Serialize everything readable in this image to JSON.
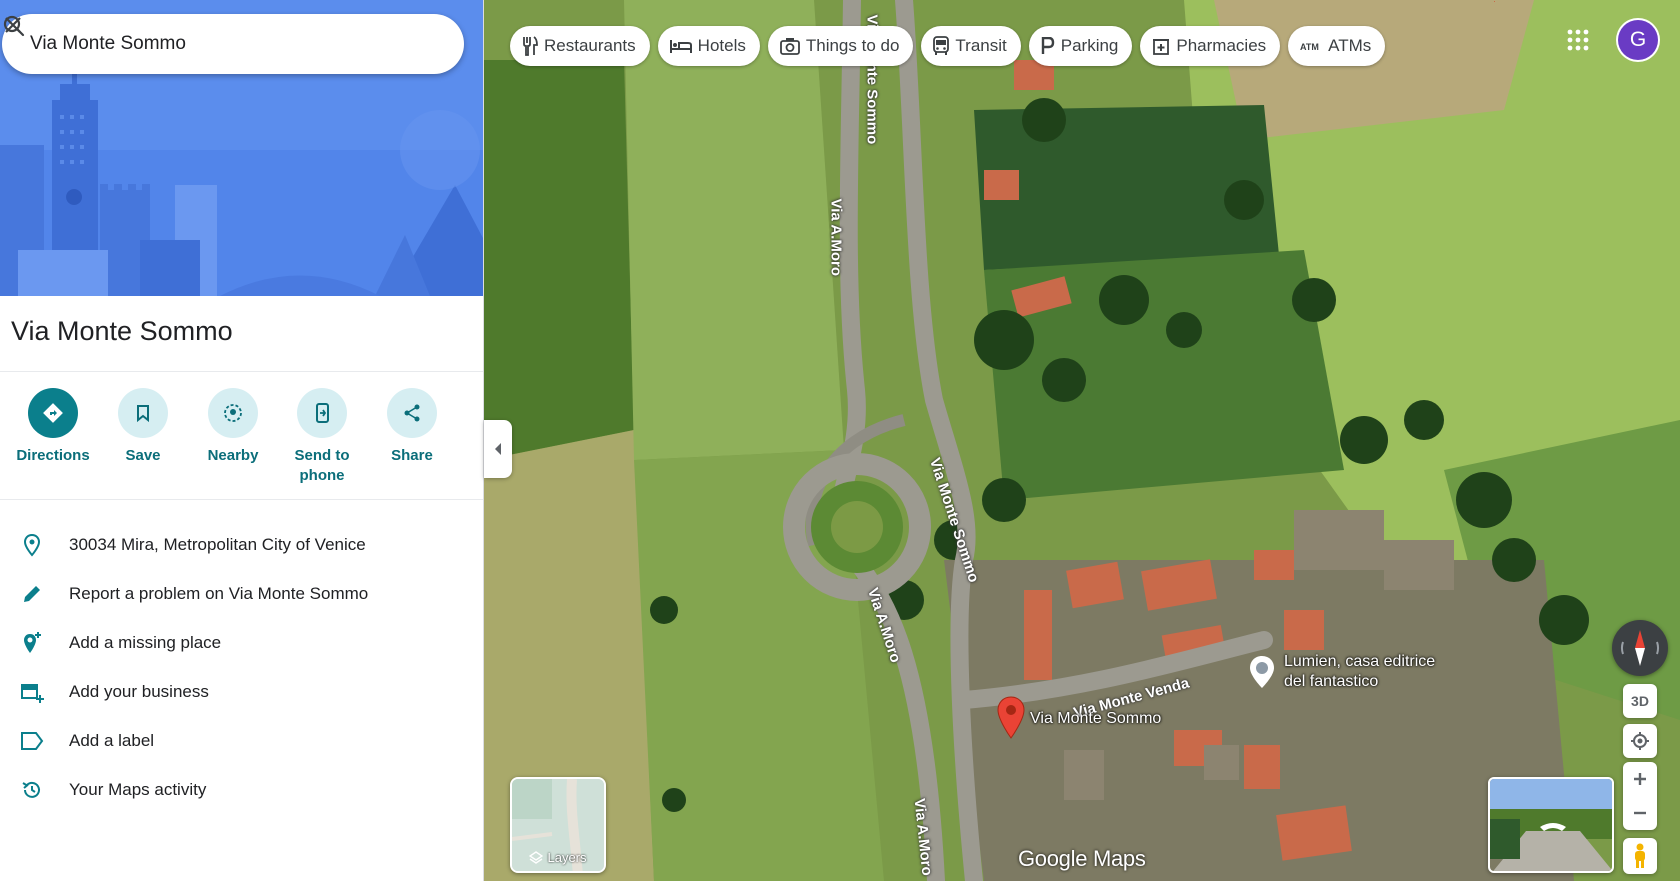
{
  "search": {
    "value": "Via Monte Sommo"
  },
  "place": {
    "title": "Via Monte Sommo"
  },
  "actions": [
    {
      "label": "Directions",
      "icon": "directions-icon"
    },
    {
      "label": "Save",
      "icon": "bookmark-icon"
    },
    {
      "label": "Nearby",
      "icon": "nearby-icon"
    },
    {
      "label": "Send to phone",
      "icon": "send-to-phone-icon"
    },
    {
      "label": "Share",
      "icon": "share-icon"
    }
  ],
  "info": [
    {
      "text": "30034 Mira, Metropolitan City of Venice",
      "icon": "location-pin-icon"
    },
    {
      "text": "Report a problem on Via Monte Sommo",
      "icon": "pencil-icon"
    },
    {
      "text": "Add a missing place",
      "icon": "add-place-icon"
    },
    {
      "text": "Add your business",
      "icon": "add-business-icon"
    },
    {
      "text": "Add a label",
      "icon": "label-icon"
    },
    {
      "text": "Your Maps activity",
      "icon": "history-icon"
    }
  ],
  "chips": [
    {
      "label": "Restaurants",
      "icon": "fork-knife-icon"
    },
    {
      "label": "Hotels",
      "icon": "bed-icon"
    },
    {
      "label": "Things to do",
      "icon": "camera-icon"
    },
    {
      "label": "Transit",
      "icon": "bus-icon"
    },
    {
      "label": "Parking",
      "icon": "parking-icon"
    },
    {
      "label": "Pharmacies",
      "icon": "pharmacy-icon"
    },
    {
      "label": "ATMs",
      "icon": "atm-icon"
    }
  ],
  "user": {
    "initial": "G"
  },
  "map": {
    "roads": {
      "via_moro_top": "Via A.Moro",
      "via_monte_sommo_top": "Via Monte Sommo",
      "via_monte_sommo_mid": "Via Monte Sommo",
      "via_moro_mid": "Via A.Moro",
      "via_moro_bottom": "Via A.Moro",
      "via_monte_venda": "Via Monte Venda"
    },
    "pin_label": "Via Monte Sommo",
    "poi": {
      "line1": "Lumien, casa editrice",
      "line2": "del fantastico"
    },
    "layers_label": "Layers",
    "tilt_label": "3D",
    "watermark": "Google Maps"
  },
  "colors": {
    "accent": "#0b7f8c",
    "pin": "#ea4335",
    "avatar": "#6a3bc4"
  }
}
